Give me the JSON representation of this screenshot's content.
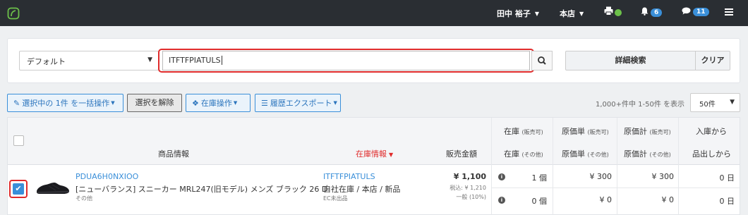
{
  "topbar": {
    "user": "田中 裕子",
    "store": "本店",
    "notifications_count": "6",
    "messages_count": "11"
  },
  "search": {
    "preset_value": "デフォルト",
    "keyword_value": "ITFTFPIATULS",
    "detail_label": "詳細検索",
    "clear_label": "クリア"
  },
  "actions": {
    "bulk_label": "選択中の 1件 を一括操作",
    "deselect_label": "選択を解除",
    "stock_label": "在庫操作",
    "export_label": "履歴エクスポート",
    "count_text": "1,000+件中 1-50件 を表示",
    "per_page": "50件"
  },
  "table": {
    "headers": {
      "product_info": "商品情報",
      "stock_info": "在庫情報",
      "sale_price": "販売金額",
      "stock_main": "在庫",
      "stock_main_note": "(販売可)",
      "stock_other": "在庫",
      "stock_other_note": "(その他)",
      "unit_cost_main": "原価単",
      "unit_cost_main_note": "(販売可)",
      "unit_cost_other": "原価単",
      "unit_cost_other_note": "(その他)",
      "total_cost_main": "原価計",
      "total_cost_main_note": "(販売可)",
      "total_cost_other": "原価計",
      "total_cost_other_note": "(その他)",
      "since_in": "入庫から",
      "since_out": "品出しから"
    },
    "row": {
      "sku": "PDUA6H0NXIOO",
      "name": "[ニューバランス] スニーカー MRL247(旧モデル) メンズ ブラック 26 D",
      "category": "その他",
      "stock_code": "ITFTFPIATULS",
      "stock_location": "自社在庫 / 本店 / 新品",
      "ec_status": "EC未出品",
      "price": "¥ 1,100",
      "price_tax": "税込: ¥ 1,210",
      "price_rate": "一般 (10%)",
      "sellable": {
        "stock": "1 個",
        "unit_cost": "¥ 300",
        "total_cost": "¥ 300",
        "days": "0 日"
      },
      "other": {
        "stock": "0 個",
        "unit_cost": "¥ 0",
        "total_cost": "¥ 0",
        "days": "0 日"
      }
    }
  },
  "colors": {
    "topbar": "#2a2e33",
    "accent": "#3a8fd9",
    "highlight": "#e02b2b",
    "status_ok": "#6cc04a"
  }
}
